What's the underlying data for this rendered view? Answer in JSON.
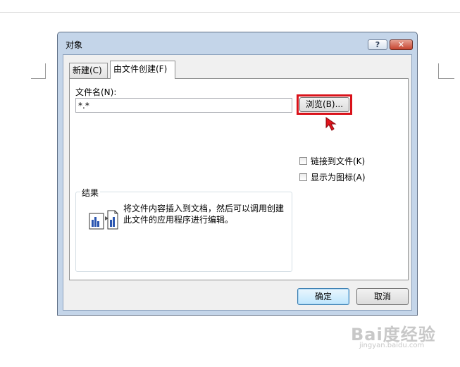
{
  "dialog": {
    "title": "对象",
    "help_label": "?",
    "close_label": "✕",
    "tabs": [
      {
        "label": "新建(C)",
        "active": false
      },
      {
        "label": "由文件创建(F)",
        "active": true
      }
    ],
    "filename_label": "文件名(N):",
    "filename_value": "*.*",
    "browse_label": "浏览(B)...",
    "link_to_file_label": "链接到文件(K)",
    "link_to_file_checked": false,
    "display_as_icon_label": "显示为图标(A)",
    "display_as_icon_checked": false,
    "result_label": "结果",
    "result_text": "将文件内容插入到文档，然后可以调用创建此文件的应用程序进行编辑。",
    "ok_label": "确定",
    "cancel_label": "取消"
  },
  "watermark": {
    "brand": "Bai度经验",
    "url": "jingyan.baidu.com"
  },
  "colors": {
    "highlight": "#d9121a",
    "dialog_frame": "#c4d5e9"
  }
}
